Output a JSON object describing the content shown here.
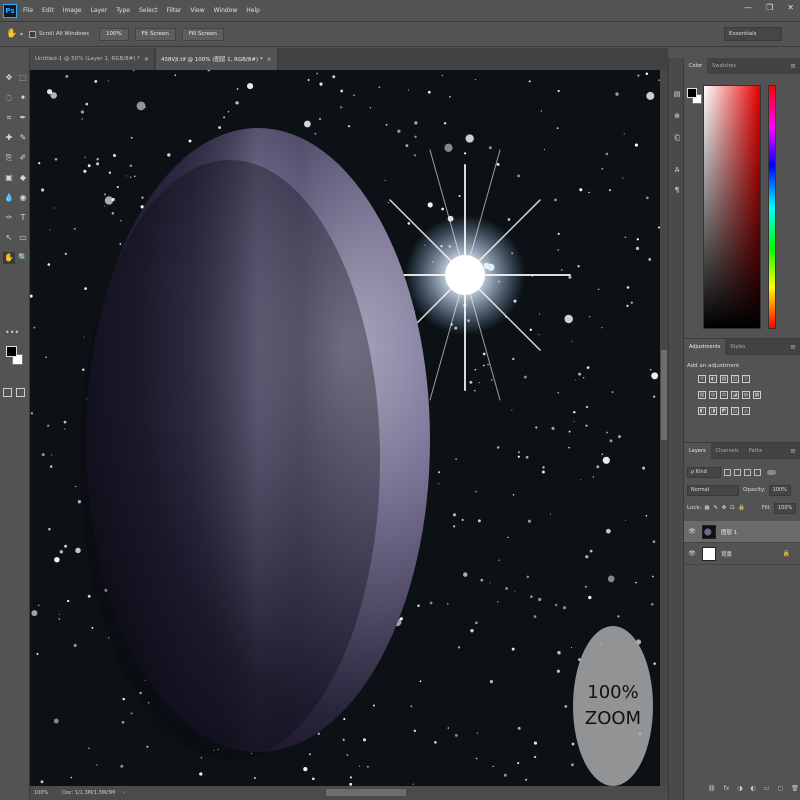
{
  "app": {
    "logo": "Ps"
  },
  "menu": [
    "File",
    "Edit",
    "Image",
    "Layer",
    "Type",
    "Select",
    "Filter",
    "View",
    "Window",
    "Help"
  ],
  "window_controls": {
    "minimize": "—",
    "restore": "❐",
    "close": "✕"
  },
  "options_bar": {
    "tool_icon": "hand-icon",
    "scroll_all_windows": "Scroll All Windows",
    "zoom_value": "100%",
    "fit_screen": "Fit Screen",
    "fill_screen": "Fill Screen",
    "workspace": "Essentials"
  },
  "doc_tabs": [
    {
      "label": "Untitled-1 @ 50% (Layer 1, RGB/8#) *",
      "active": false
    },
    {
      "label": "438VJI.tif @ 100% (图层 1, RGB/8#) *",
      "active": true
    }
  ],
  "tools": [
    "✥",
    "⬚",
    "◌",
    "✦",
    "⌗",
    "✒",
    "✚",
    "✎",
    "⎘",
    "✐",
    "▣",
    "◆",
    "💧",
    "◉",
    "✑",
    "T",
    "↖",
    "▭",
    "✋",
    "🔍"
  ],
  "more_tools": "•••",
  "canvas": {
    "zoom_badge_line1": "100%",
    "zoom_badge_line2": "ZOOM"
  },
  "status_bar": {
    "zoom": "100%",
    "doc": "Doc: 1/1.3M/1.3M/3M",
    "arrow": "›"
  },
  "right_icons": [
    "▤",
    "⊕",
    "⎗",
    "A",
    "¶"
  ],
  "color_panel": {
    "tabs": [
      "Color",
      "Swatches"
    ],
    "menu": "≡"
  },
  "adjustments_panel": {
    "tabs": [
      "Adjustments",
      "Styles"
    ],
    "title": "Add an adjustment",
    "menu": "≡",
    "row1": [
      "☼",
      "◐",
      "▨",
      "◫",
      "▽"
    ],
    "row2": [
      "▥",
      "◎",
      "⚖",
      "◪",
      "◍",
      "▦"
    ],
    "row3": [
      "◧",
      "◨",
      "◩",
      "◫",
      "◬"
    ]
  },
  "layers_panel": {
    "tabs": [
      "Layers",
      "Channels",
      "Paths"
    ],
    "menu": "≡",
    "filter_kind": "ρ Kind",
    "blend_mode": "Normal",
    "opacity_label": "Opacity:",
    "opacity_value": "100%",
    "lock_label": "Lock:",
    "lock_icons": "▦ ✎ ✥ ⊡ 🔒",
    "fill_label": "Fill:",
    "fill_value": "100%",
    "layers": [
      {
        "name": "图层 1",
        "selected": true,
        "thumb": "space",
        "eye": "👁",
        "lock": ""
      },
      {
        "name": "背景",
        "selected": false,
        "thumb": "white",
        "eye": "👁",
        "lock": "🔒"
      }
    ],
    "footer": [
      "⛓",
      "fx",
      "◑",
      "◐",
      "▭",
      "▢",
      "🗑"
    ]
  }
}
